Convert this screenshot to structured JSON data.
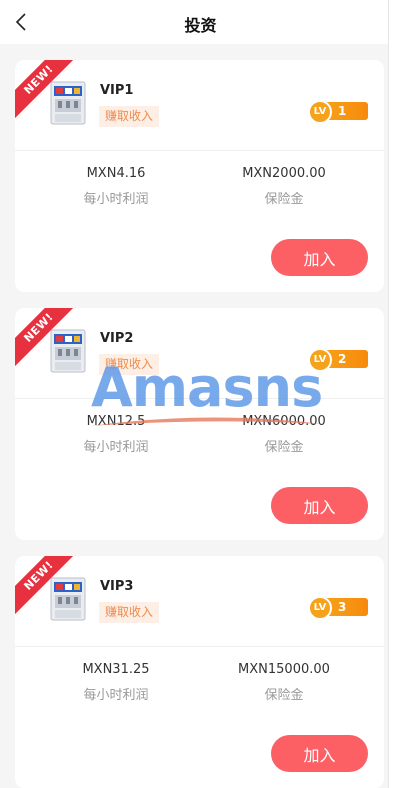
{
  "header": {
    "title": "投资"
  },
  "cards": [
    {
      "ribbon": "NEW!",
      "name": "VIP1",
      "badge": "赚取收入",
      "level": "1",
      "profit_value": "MXN4.16",
      "profit_label": "每小时利润",
      "deposit_value": "MXN2000.00",
      "deposit_label": "保险金",
      "button": "加入"
    },
    {
      "ribbon": "NEW!",
      "name": "VIP2",
      "badge": "赚取收入",
      "level": "2",
      "profit_value": "MXN12.5",
      "profit_label": "每小时利润",
      "deposit_value": "MXN6000.00",
      "deposit_label": "保险金",
      "button": "加入"
    },
    {
      "ribbon": "NEW!",
      "name": "VIP3",
      "badge": "赚取收入",
      "level": "3",
      "profit_value": "MXN31.25",
      "profit_label": "每小时利润",
      "deposit_value": "MXN15000.00",
      "deposit_label": "保险金",
      "button": "加入"
    }
  ],
  "level_prefix": "LV",
  "watermark": "Amasns",
  "colors": {
    "ribbon": "#e8313f",
    "button": "#fc6065",
    "level": "#f7a21b",
    "badge_text": "#f08a4b"
  },
  "icons": {
    "back": "chevron-left-icon",
    "product": "drink-machine-icon"
  }
}
